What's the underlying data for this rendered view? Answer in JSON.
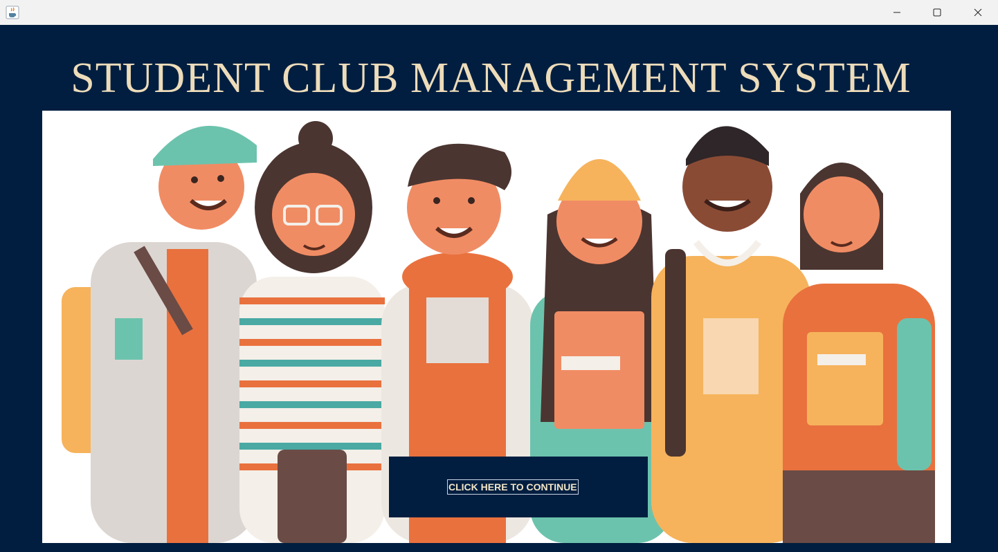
{
  "window": {
    "icon": "java-coffee-icon",
    "controls": [
      "minimize-icon",
      "maximize-icon",
      "close-icon"
    ]
  },
  "main": {
    "title": "STUDENT CLUB MANAGEMENT SYSTEM",
    "continue_label": "CLICK HERE TO CONTINUE",
    "hero_image": "illustration-group-of-six-students-with-backpacks"
  },
  "colors": {
    "background": "#011e40",
    "title_text": "#eddcba",
    "titlebar": "#f2f2f2",
    "button_text": "#f3e6c8"
  }
}
